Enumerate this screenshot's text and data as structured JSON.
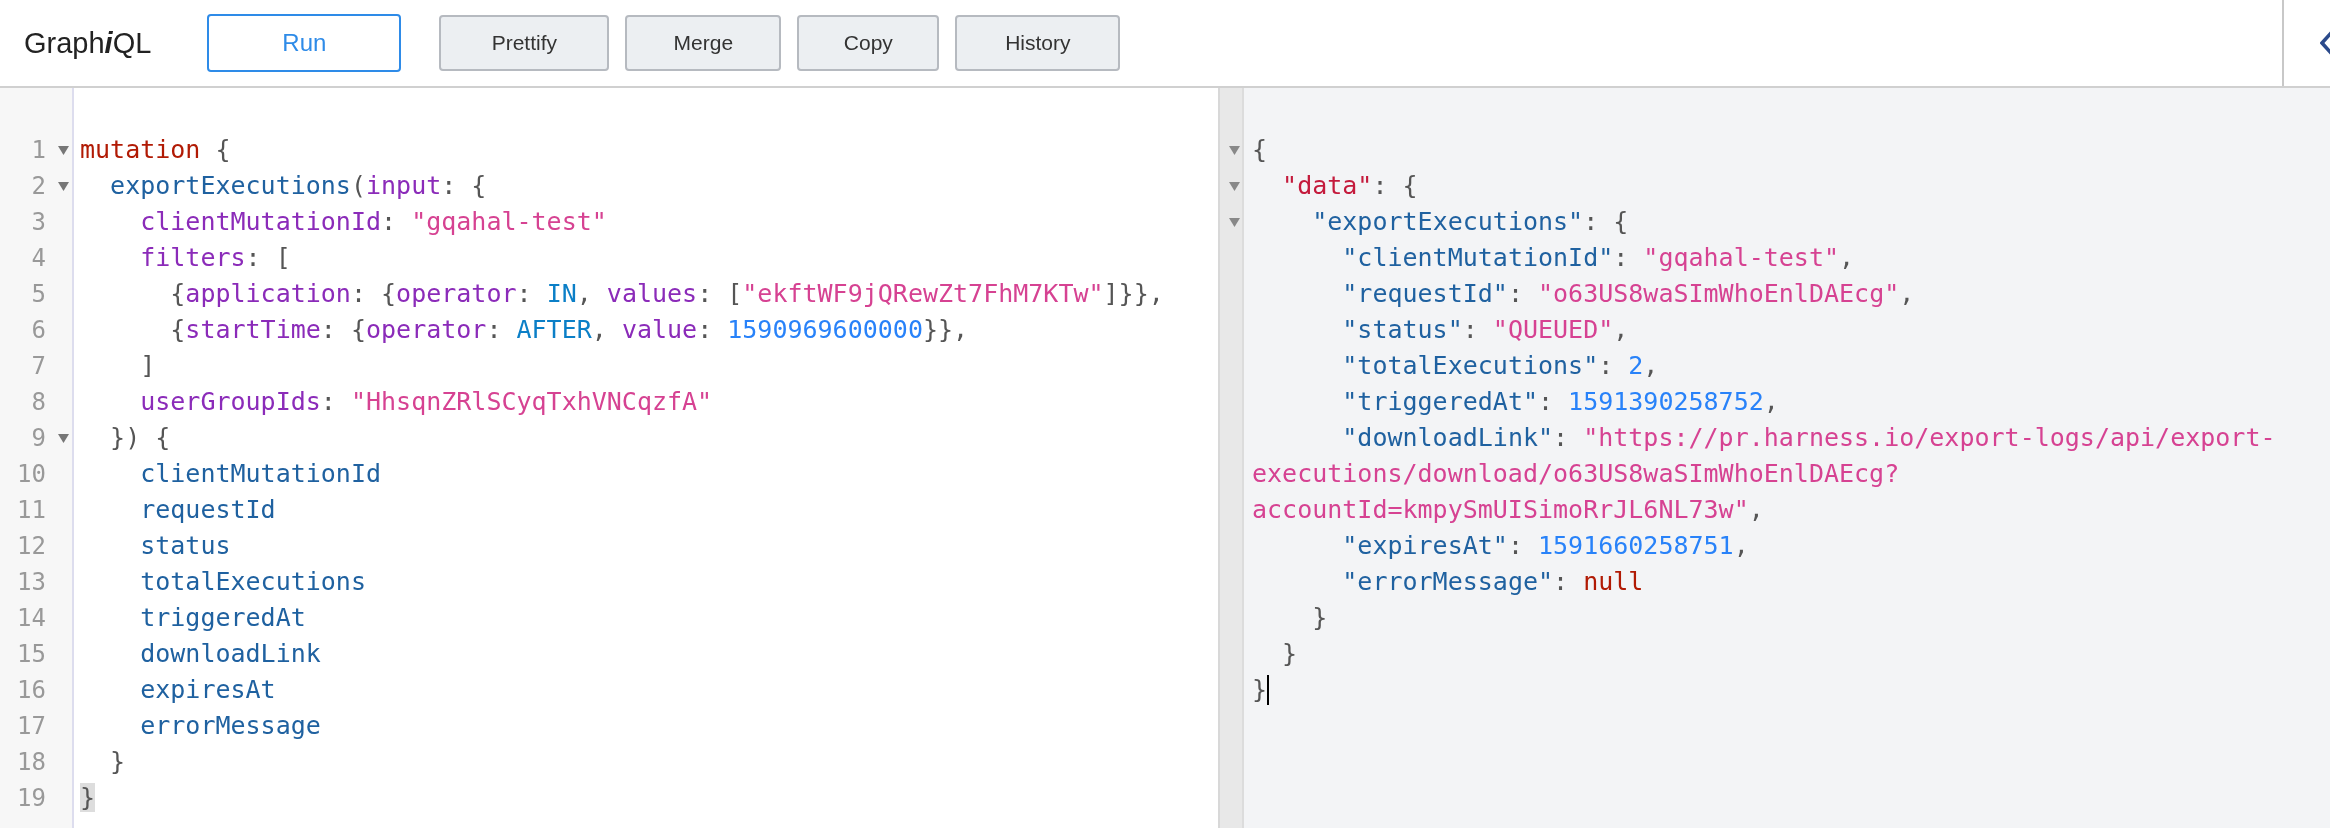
{
  "logo": [
    {
      "kind": "plain",
      "text": "Graph"
    },
    {
      "kind": "italic",
      "text": "i"
    },
    {
      "kind": "plain",
      "text": "QL"
    }
  ],
  "toolbar": {
    "buttons": [
      {
        "label": "Run",
        "kind": "primary"
      },
      {
        "label": "Prettify",
        "kind": "secondary"
      },
      {
        "label": "Merge",
        "kind": "secondary"
      },
      {
        "label": "Copy",
        "kind": "secondary"
      },
      {
        "label": "History",
        "kind": "secondary"
      }
    ]
  },
  "query_editor": {
    "lines": [
      {
        "number": "1",
        "fold": true,
        "tokens": [
          {
            "kind": "keyword",
            "text": "mutation"
          },
          {
            "kind": "punct",
            "text": " {"
          }
        ]
      },
      {
        "number": "2",
        "fold": true,
        "tokens": [
          {
            "kind": "def",
            "text": "  exportExecutions"
          },
          {
            "kind": "punct",
            "text": "("
          },
          {
            "kind": "attr",
            "text": "input"
          },
          {
            "kind": "punct",
            "text": ": {"
          }
        ]
      },
      {
        "number": "3",
        "fold": false,
        "tokens": [
          {
            "kind": "attr",
            "text": "    clientMutationId"
          },
          {
            "kind": "punct",
            "text": ": "
          },
          {
            "kind": "string",
            "text": "\"gqahal-test\""
          }
        ]
      },
      {
        "number": "4",
        "fold": false,
        "tokens": [
          {
            "kind": "attr",
            "text": "    filters"
          },
          {
            "kind": "punct",
            "text": ": ["
          }
        ]
      },
      {
        "number": "5",
        "fold": false,
        "tokens": [
          {
            "kind": "punct",
            "text": "      {"
          },
          {
            "kind": "attr",
            "text": "application"
          },
          {
            "kind": "punct",
            "text": ": {"
          },
          {
            "kind": "attr",
            "text": "operator"
          },
          {
            "kind": "punct",
            "text": ": "
          },
          {
            "kind": "enum",
            "text": "IN"
          },
          {
            "kind": "punct",
            "text": ", "
          },
          {
            "kind": "attr",
            "text": "values"
          },
          {
            "kind": "punct",
            "text": ": ["
          },
          {
            "kind": "string",
            "text": "\"ekftWF9jQRewZt7FhM7KTw\""
          },
          {
            "kind": "punct",
            "text": "]}},"
          }
        ]
      },
      {
        "number": "6",
        "fold": false,
        "tokens": [
          {
            "kind": "punct",
            "text": "      {"
          },
          {
            "kind": "attr",
            "text": "startTime"
          },
          {
            "kind": "punct",
            "text": ": {"
          },
          {
            "kind": "attr",
            "text": "operator"
          },
          {
            "kind": "punct",
            "text": ": "
          },
          {
            "kind": "enum",
            "text": "AFTER"
          },
          {
            "kind": "punct",
            "text": ", "
          },
          {
            "kind": "attr",
            "text": "value"
          },
          {
            "kind": "punct",
            "text": ": "
          },
          {
            "kind": "number",
            "text": "1590969600000"
          },
          {
            "kind": "punct",
            "text": "}},"
          }
        ]
      },
      {
        "number": "7",
        "fold": false,
        "tokens": [
          {
            "kind": "punct",
            "text": "    ]"
          }
        ]
      },
      {
        "number": "8",
        "fold": false,
        "tokens": [
          {
            "kind": "attr",
            "text": "    userGroupIds"
          },
          {
            "kind": "punct",
            "text": ": "
          },
          {
            "kind": "string",
            "text": "\"HhsqnZRlSCyqTxhVNCqzfA\""
          }
        ]
      },
      {
        "number": "9",
        "fold": true,
        "tokens": [
          {
            "kind": "punct",
            "text": "  }) {"
          }
        ]
      },
      {
        "number": "10",
        "fold": false,
        "tokens": [
          {
            "kind": "field",
            "text": "    clientMutationId"
          }
        ]
      },
      {
        "number": "11",
        "fold": false,
        "tokens": [
          {
            "kind": "field",
            "text": "    requestId"
          }
        ]
      },
      {
        "number": "12",
        "fold": false,
        "tokens": [
          {
            "kind": "field",
            "text": "    status"
          }
        ]
      },
      {
        "number": "13",
        "fold": false,
        "tokens": [
          {
            "kind": "field",
            "text": "    totalExecutions"
          }
        ]
      },
      {
        "number": "14",
        "fold": false,
        "tokens": [
          {
            "kind": "field",
            "text": "    triggeredAt"
          }
        ]
      },
      {
        "number": "15",
        "fold": false,
        "tokens": [
          {
            "kind": "field",
            "text": "    downloadLink"
          }
        ]
      },
      {
        "number": "16",
        "fold": false,
        "tokens": [
          {
            "kind": "field",
            "text": "    expiresAt"
          }
        ]
      },
      {
        "number": "17",
        "fold": false,
        "tokens": [
          {
            "kind": "field",
            "text": "    errorMessage"
          }
        ]
      },
      {
        "number": "18",
        "fold": false,
        "tokens": [
          {
            "kind": "punct",
            "text": "  }"
          }
        ]
      },
      {
        "number": "19",
        "fold": false,
        "tokens": [
          {
            "kind": "matched-bracket",
            "text": "}"
          }
        ]
      }
    ]
  },
  "result_viewer": {
    "lines": [
      {
        "fold": true,
        "tokens": [
          {
            "kind": "punct",
            "text": "{"
          }
        ]
      },
      {
        "fold": true,
        "tokens": [
          {
            "kind": "datakey",
            "text": "  \"data\""
          },
          {
            "kind": "punct",
            "text": ": {"
          }
        ]
      },
      {
        "fold": true,
        "tokens": [
          {
            "kind": "key",
            "text": "    \"exportExecutions\""
          },
          {
            "kind": "punct",
            "text": ": {"
          }
        ]
      },
      {
        "fold": false,
        "tokens": [
          {
            "kind": "key",
            "text": "      \"clientMutationId\""
          },
          {
            "kind": "punct",
            "text": ": "
          },
          {
            "kind": "string",
            "text": "\"gqahal-test\""
          },
          {
            "kind": "punct",
            "text": ","
          }
        ]
      },
      {
        "fold": false,
        "tokens": [
          {
            "kind": "key",
            "text": "      \"requestId\""
          },
          {
            "kind": "punct",
            "text": ": "
          },
          {
            "kind": "string",
            "text": "\"o63US8waSImWhoEnlDAEcg\""
          },
          {
            "kind": "punct",
            "text": ","
          }
        ]
      },
      {
        "fold": false,
        "tokens": [
          {
            "kind": "key",
            "text": "      \"status\""
          },
          {
            "kind": "punct",
            "text": ": "
          },
          {
            "kind": "string",
            "text": "\"QUEUED\""
          },
          {
            "kind": "punct",
            "text": ","
          }
        ]
      },
      {
        "fold": false,
        "tokens": [
          {
            "kind": "key",
            "text": "      \"totalExecutions\""
          },
          {
            "kind": "punct",
            "text": ": "
          },
          {
            "kind": "number",
            "text": "2"
          },
          {
            "kind": "punct",
            "text": ","
          }
        ]
      },
      {
        "fold": false,
        "tokens": [
          {
            "kind": "key",
            "text": "      \"triggeredAt\""
          },
          {
            "kind": "punct",
            "text": ": "
          },
          {
            "kind": "number",
            "text": "1591390258752"
          },
          {
            "kind": "punct",
            "text": ","
          }
        ]
      },
      {
        "fold": false,
        "tokens": [
          {
            "kind": "key",
            "text": "      \"downloadLink\""
          },
          {
            "kind": "punct",
            "text": ": "
          },
          {
            "kind": "string",
            "text": "\"https://pr.harness.io/export-logs/api/export-executions/download/o63US8waSImWhoEnlDAEcg?accountId=kmpySmUISimoRrJL6NL73w\""
          },
          {
            "kind": "punct",
            "text": ","
          }
        ]
      },
      {
        "fold": false,
        "tokens": [
          {
            "kind": "key",
            "text": "      \"expiresAt\""
          },
          {
            "kind": "punct",
            "text": ": "
          },
          {
            "kind": "number",
            "text": "1591660258751"
          },
          {
            "kind": "punct",
            "text": ","
          }
        ]
      },
      {
        "fold": false,
        "tokens": [
          {
            "kind": "key",
            "text": "      \"errorMessage\""
          },
          {
            "kind": "punct",
            "text": ": "
          },
          {
            "kind": "keyword",
            "text": "null"
          }
        ]
      },
      {
        "fold": false,
        "tokens": [
          {
            "kind": "punct",
            "text": "    }"
          }
        ]
      },
      {
        "fold": false,
        "tokens": [
          {
            "kind": "punct",
            "text": "  }"
          }
        ]
      },
      {
        "fold": false,
        "cursor": true,
        "tokens": [
          {
            "kind": "punct",
            "text": "}"
          }
        ]
      }
    ]
  }
}
